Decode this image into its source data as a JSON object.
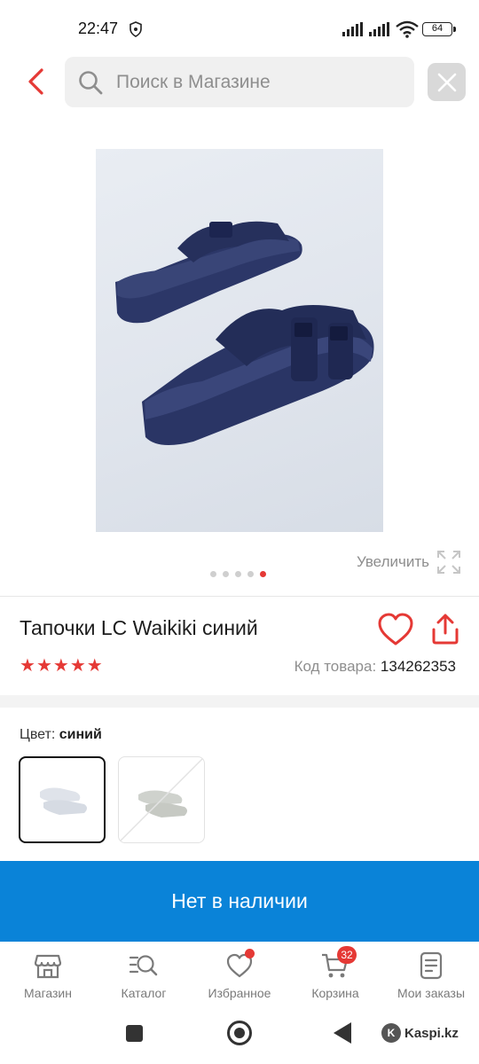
{
  "status_bar": {
    "time": "22:47",
    "battery": "64"
  },
  "header": {
    "search_placeholder": "Поиск в Магазине"
  },
  "gallery": {
    "zoom_label": "Увеличить",
    "dot_count": 5,
    "active_index": 4
  },
  "product": {
    "title": "Тапочки LC Waikiki синий",
    "rating_stars": 5,
    "code_label": "Код товара:",
    "code_value": "134262353"
  },
  "color": {
    "label": "Цвет:",
    "selected": "синий"
  },
  "cta_label": "Нет в наличии",
  "bottom_nav": {
    "items": [
      {
        "label": "Магазин",
        "icon": "store-icon"
      },
      {
        "label": "Каталог",
        "icon": "catalog-search-icon"
      },
      {
        "label": "Избранное",
        "icon": "heart-icon"
      },
      {
        "label": "Корзина",
        "icon": "cart-icon",
        "badge": "32"
      },
      {
        "label": "Мои заказы",
        "icon": "orders-icon"
      }
    ]
  },
  "watermark": "Kaspi.kz",
  "colors": {
    "accent_red": "#e53935",
    "cta_blue": "#0a83d8"
  }
}
